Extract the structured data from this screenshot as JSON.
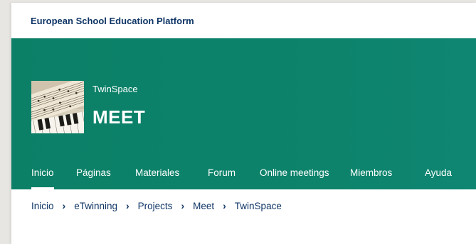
{
  "header": {
    "platform_title": "European School Education Platform"
  },
  "banner": {
    "space_label": "TwinSpace",
    "space_title": "MEET",
    "thumbnail_icon": "sheet-music-piano-image"
  },
  "nav": {
    "items": [
      {
        "label": "Inicio",
        "active": true
      },
      {
        "label": "Páginas"
      },
      {
        "label": "Materiales"
      },
      {
        "label": "Forum"
      },
      {
        "label": "Online meetings"
      },
      {
        "label": "Miembros"
      },
      {
        "label": "Ayuda"
      }
    ]
  },
  "breadcrumb": {
    "items": [
      "Inicio",
      "eTwinning",
      "Projects",
      "Meet",
      "TwinSpace"
    ],
    "separator": "›"
  },
  "colors": {
    "banner": "#0d836c",
    "link": "#0f3566"
  }
}
